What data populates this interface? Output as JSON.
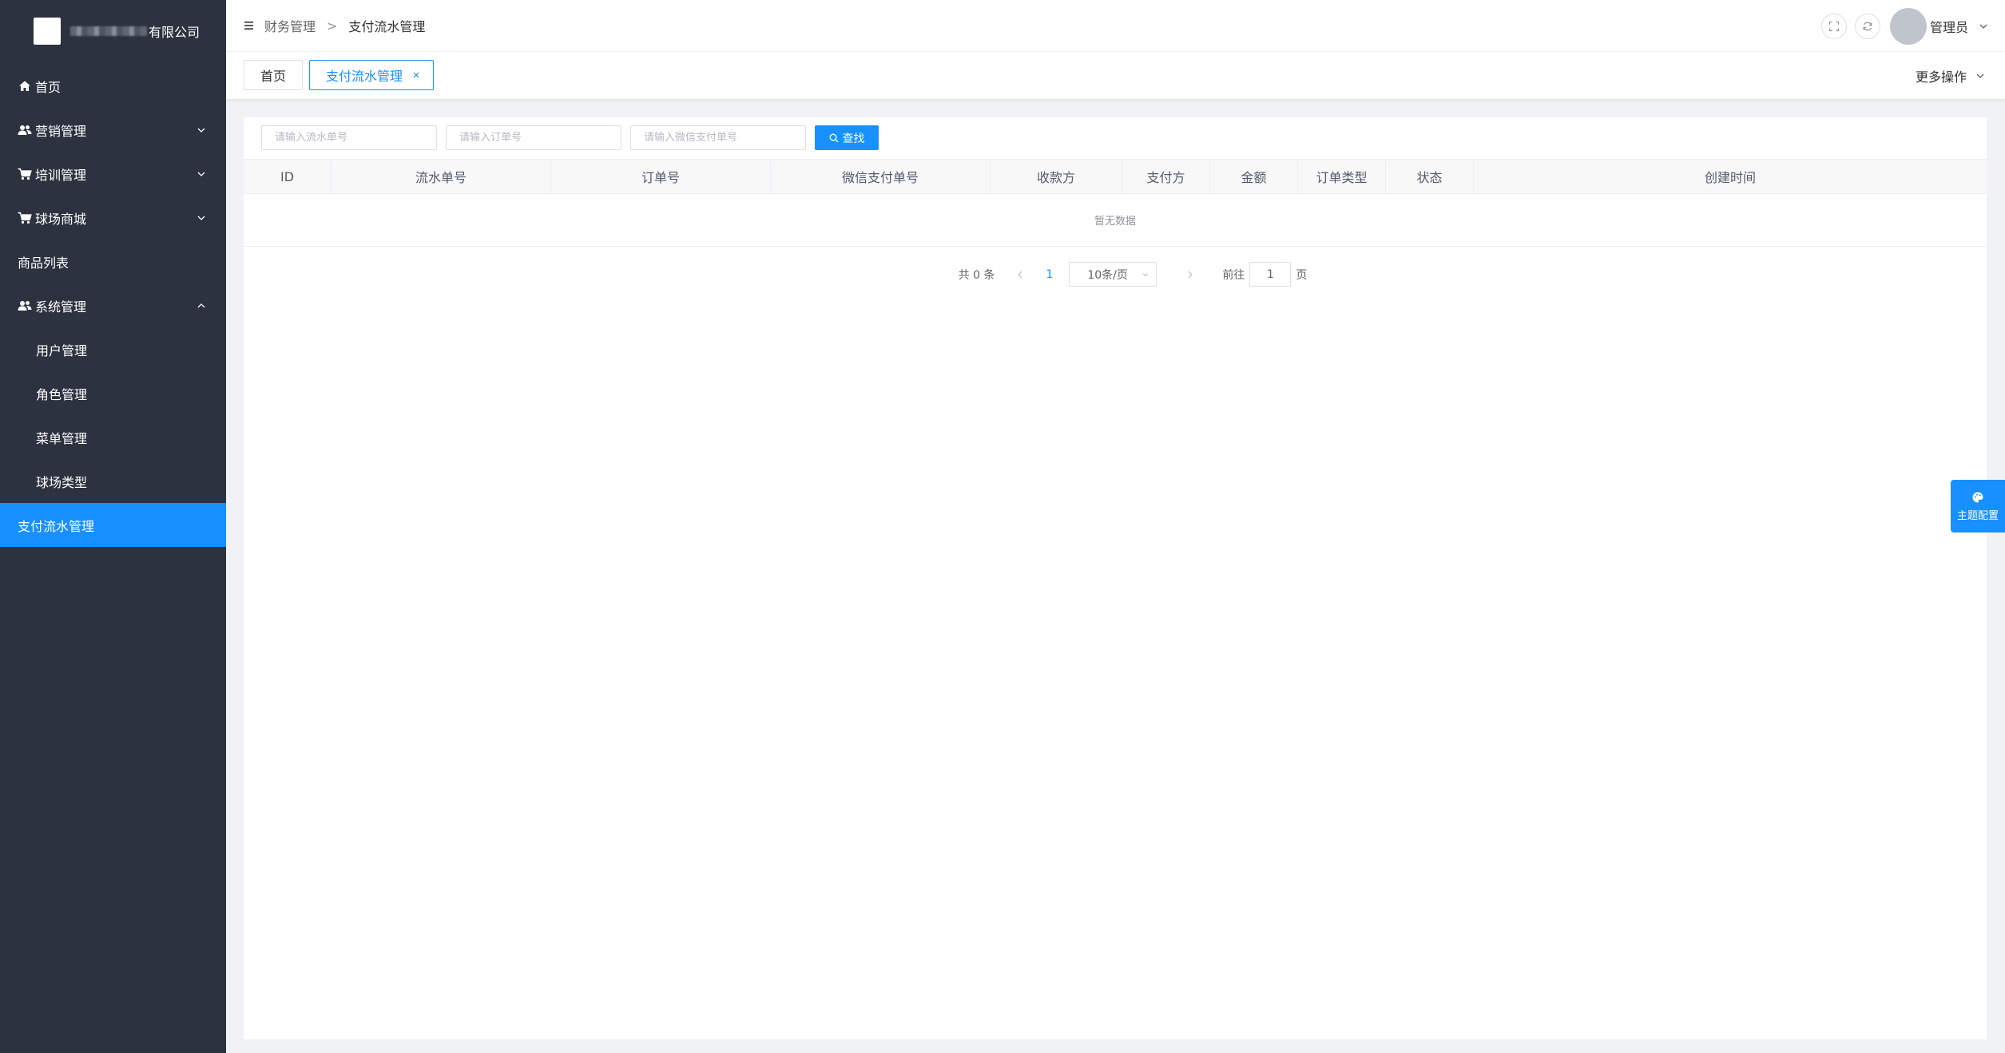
{
  "sidebar": {
    "logo_text": "有限公司",
    "items": [
      {
        "label": "首页",
        "icon": "home-icon"
      },
      {
        "label": "营销管理",
        "icon": "users-icon",
        "arrow": "down"
      },
      {
        "label": "培训管理",
        "icon": "cart-icon",
        "arrow": "down"
      },
      {
        "label": "球场商城",
        "icon": "cart-icon",
        "arrow": "down"
      },
      {
        "label": "商品列表"
      },
      {
        "label": "系统管理",
        "icon": "users-icon",
        "arrow": "up"
      },
      {
        "label": "用户管理",
        "sub": true
      },
      {
        "label": "角色管理",
        "sub": true
      },
      {
        "label": "菜单管理",
        "sub": true
      },
      {
        "label": "球场类型",
        "sub": true
      },
      {
        "label": "支付流水管理",
        "active": true
      }
    ]
  },
  "header": {
    "breadcrumb": [
      "财务管理",
      "支付流水管理"
    ],
    "breadcrumb_sep": ">",
    "user_name": "管理员"
  },
  "tabs": {
    "items": [
      {
        "label": "首页"
      },
      {
        "label": "支付流水管理",
        "active": true
      }
    ],
    "more_ops": "更多操作"
  },
  "search": {
    "serial_placeholder": "请输入流水单号",
    "order_placeholder": "请输入订单号",
    "wechat_placeholder": "请输入微信支付单号",
    "button_label": "查找"
  },
  "table": {
    "columns": [
      "ID",
      "流水单号",
      "订单号",
      "微信支付单号",
      "收款方",
      "支付方",
      "金额",
      "订单类型",
      "状态",
      "创建时间"
    ],
    "empty_text": "暂无数据"
  },
  "pagination": {
    "total_text": "共 0 条",
    "current_page": "1",
    "page_size": "10条/页",
    "goto_label": "前往",
    "goto_value": "1",
    "page_suffix": "页"
  },
  "theme_button": {
    "label": "主题配置"
  },
  "colors": {
    "accent": "#1890ff",
    "sidebar_bg": "#2c323f"
  }
}
